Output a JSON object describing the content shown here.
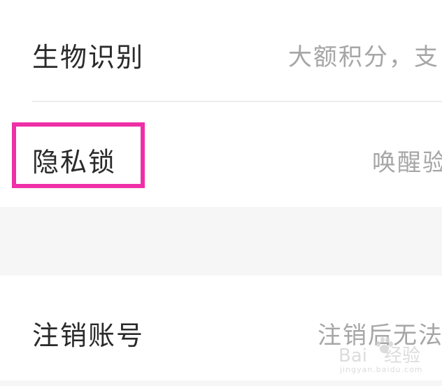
{
  "settings": {
    "rows": [
      {
        "label": "生物识别",
        "desc": "大额积分，支"
      },
      {
        "label": "隐私锁",
        "desc": "唤醒验"
      },
      {
        "label": "注销账号",
        "desc": "注销后无法"
      }
    ]
  },
  "watermark": {
    "brand": "Bai",
    "brand_tail": "经验",
    "url": "jingyan.baidu.com"
  },
  "colors": {
    "highlight": "#ee2fa7",
    "label_text": "#2a2a2a",
    "desc_text": "#a6a6a6",
    "section_gap": "#f6f6f6"
  }
}
